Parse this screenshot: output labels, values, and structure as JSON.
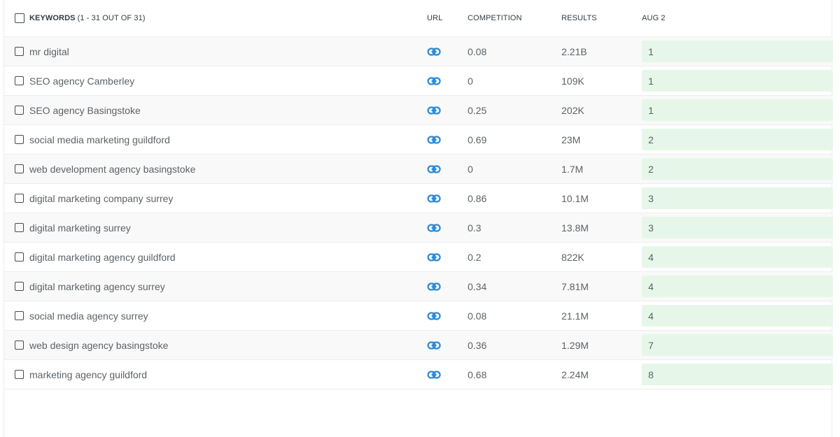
{
  "header": {
    "keywords_label": "KEYWORDS",
    "keywords_count": "(1 - 31 OUT OF 31)",
    "url_label": "URL",
    "competition_label": "COMPETITION",
    "results_label": "RESULTS",
    "date_label": "AUG 2"
  },
  "link_icon": "link-icon",
  "colors": {
    "link_icon": "#2a8ad8",
    "rank_bg": "#e6f7e9",
    "row_alt_bg": "#f9f9f9"
  },
  "rows": [
    {
      "keyword": "mr digital",
      "competition": "0.08",
      "results": "2.21B",
      "rank": "1"
    },
    {
      "keyword": "SEO agency Camberley",
      "competition": "0",
      "results": "109K",
      "rank": "1"
    },
    {
      "keyword": "SEO agency Basingstoke",
      "competition": "0.25",
      "results": "202K",
      "rank": "1"
    },
    {
      "keyword": "social media marketing guildford",
      "competition": "0.69",
      "results": "23M",
      "rank": "2"
    },
    {
      "keyword": "web development agency basingstoke",
      "competition": "0",
      "results": "1.7M",
      "rank": "2"
    },
    {
      "keyword": "digital marketing company surrey",
      "competition": "0.86",
      "results": "10.1M",
      "rank": "3"
    },
    {
      "keyword": "digital marketing surrey",
      "competition": "0.3",
      "results": "13.8M",
      "rank": "3"
    },
    {
      "keyword": "digital marketing agency guildford",
      "competition": "0.2",
      "results": "822K",
      "rank": "4"
    },
    {
      "keyword": "digital marketing agency surrey",
      "competition": "0.34",
      "results": "7.81M",
      "rank": "4"
    },
    {
      "keyword": "social media agency surrey",
      "competition": "0.08",
      "results": "21.1M",
      "rank": "4"
    },
    {
      "keyword": "web design agency basingstoke",
      "competition": "0.36",
      "results": "1.29M",
      "rank": "7"
    },
    {
      "keyword": "marketing agency guildford",
      "competition": "0.68",
      "results": "2.24M",
      "rank": "8"
    }
  ]
}
